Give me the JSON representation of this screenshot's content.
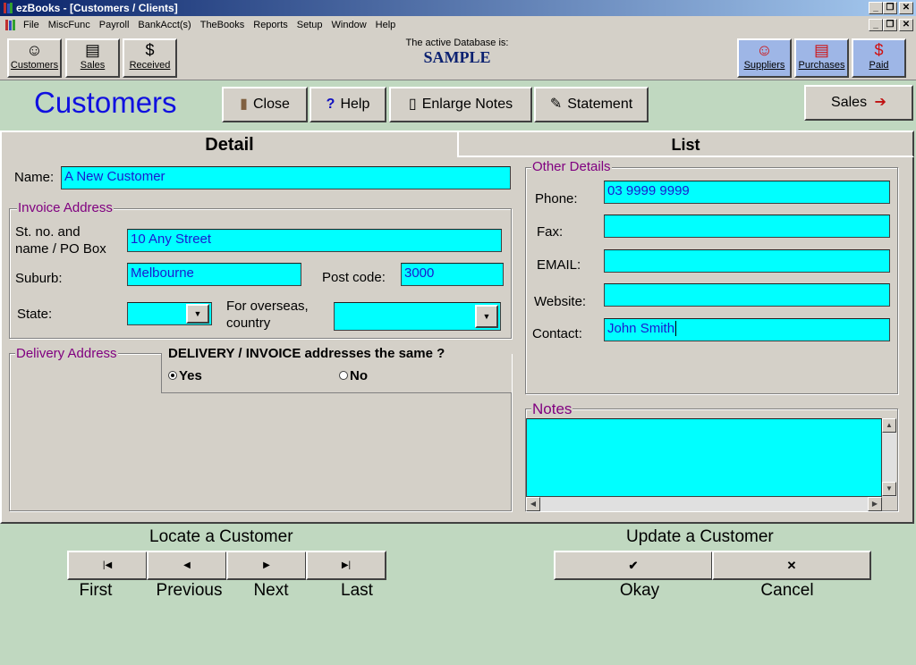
{
  "window": {
    "title": "ezBooks - [Customers / Clients]"
  },
  "menu": [
    "File",
    "MiscFunc",
    "Payroll",
    "BankAcct(s)",
    "TheBooks",
    "Reports",
    "Setup",
    "Window",
    "Help"
  ],
  "toolbar": {
    "left_buttons": [
      {
        "label": "Customers",
        "icon": "smiley-icon",
        "glyph": "☺"
      },
      {
        "label": "Sales",
        "icon": "documents-icon",
        "glyph": "▤"
      },
      {
        "label": "Received",
        "icon": "dollar-icon",
        "glyph": "$"
      }
    ],
    "right_buttons": [
      {
        "label": "Suppliers",
        "icon": "smiley-icon",
        "glyph": "☺"
      },
      {
        "label": "Purchases",
        "icon": "documents-icon",
        "glyph": "▤"
      },
      {
        "label": "Paid",
        "icon": "dollar-icon",
        "glyph": "$"
      }
    ],
    "active_db_label": "The active Database is:",
    "db_name": "SAMPLE"
  },
  "header": {
    "title": "Customers",
    "buttons": {
      "close": "Close",
      "help": "Help",
      "enlarge_notes": "Enlarge Notes",
      "statement": "Statement",
      "sales": "Sales"
    }
  },
  "tabs": {
    "detail": "Detail",
    "list": "List"
  },
  "detail": {
    "name_label": "Name:",
    "name_value": "A New Customer",
    "invoice": {
      "legend": "Invoice Address",
      "street_label_1": "St. no. and",
      "street_label_2": "name / PO Box",
      "street_value": "10 Any Street",
      "suburb_label": "Suburb:",
      "suburb_value": "Melbourne",
      "postcode_label": "Post code:",
      "postcode_value": "3000",
      "state_label": "State:",
      "state_value": "",
      "country_label_1": "For overseas,",
      "country_label_2": "country",
      "country_value": ""
    },
    "delivery": {
      "legend": "Delivery Address",
      "same_question": "DELIVERY / INVOICE addresses the same ?",
      "yes": "Yes",
      "no": "No"
    },
    "other": {
      "legend": "Other Details",
      "phone_label": "Phone:",
      "phone_value": "03 9999 9999",
      "fax_label": "Fax:",
      "fax_value": "",
      "email_label": "EMAIL:",
      "email_value": "",
      "website_label": "Website:",
      "website_value": "",
      "contact_label": "Contact:",
      "contact_value": "John Smith"
    },
    "notes": {
      "legend": "Notes",
      "value": ""
    }
  },
  "locate": {
    "heading": "Locate a Customer",
    "first": "First",
    "previous": "Previous",
    "next": "Next",
    "last": "Last"
  },
  "update": {
    "heading": "Update a Customer",
    "okay": "Okay",
    "cancel": "Cancel"
  }
}
